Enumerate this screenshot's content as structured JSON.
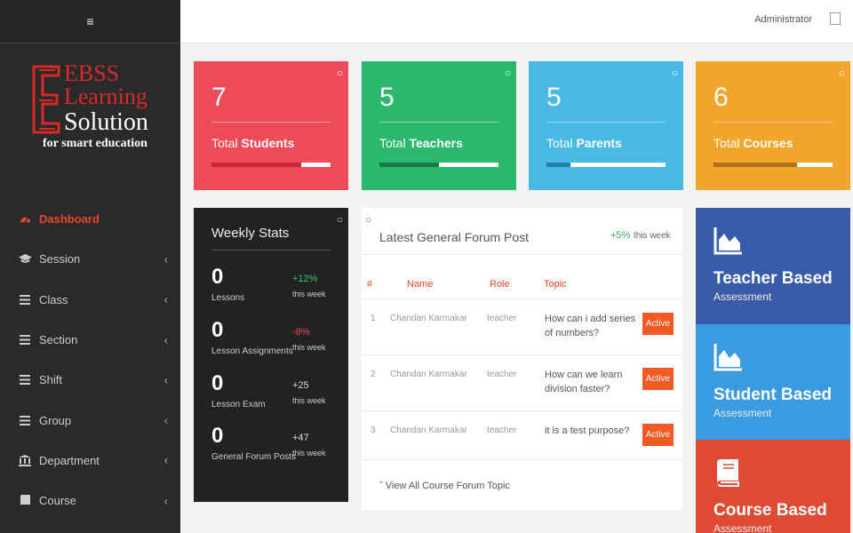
{
  "header": {
    "user": "Administrator"
  },
  "logo": {
    "line1": "EBSS",
    "line2": "Learning",
    "line3": "Solution",
    "tagline": "for smart education"
  },
  "sidebar": {
    "items": [
      {
        "label": "Dashboard",
        "icon": "dashboard-icon"
      },
      {
        "label": "Session",
        "icon": "graduation-cap-icon"
      },
      {
        "label": "Class",
        "icon": "list-icon"
      },
      {
        "label": "Section",
        "icon": "list-icon"
      },
      {
        "label": "Shift",
        "icon": "list-icon"
      },
      {
        "label": "Group",
        "icon": "list-icon"
      },
      {
        "label": "Department",
        "icon": "institution-icon"
      },
      {
        "label": "Course",
        "icon": "book-icon"
      }
    ]
  },
  "stats": [
    {
      "value": "7",
      "prefix": "Total",
      "label": "Students",
      "color": "#ee4b59",
      "progress": 0.75,
      "fill": "#c9283a"
    },
    {
      "value": "5",
      "prefix": "Total",
      "label": "Teachers",
      "color": "#2cb86c",
      "progress": 0.5,
      "fill": "#137a43"
    },
    {
      "value": "5",
      "prefix": "Total",
      "label": "Parents",
      "color": "#49b9e5",
      "progress": 0.2,
      "fill": "#1f7fa8"
    },
    {
      "value": "6",
      "prefix": "Total",
      "label": "Courses",
      "color": "#f0a52d",
      "progress": 0.7,
      "fill": "#b0701b"
    }
  ],
  "weekly": {
    "title": "Weekly Stats",
    "rows": [
      {
        "value": "0",
        "label": "Lessons",
        "change": "+12%",
        "change_color": "#3cc866",
        "period": "this week"
      },
      {
        "value": "0",
        "label": "Lesson Assignments",
        "change": "-8%",
        "change_color": "#e84a4a",
        "period": "this week"
      },
      {
        "value": "0",
        "label": "Lesson Exam",
        "change": "+25",
        "change_color": "#dddddd",
        "period": "this week"
      },
      {
        "value": "0",
        "label": "General Forum Posts",
        "change": "+47",
        "change_color": "#dddddd",
        "period": "this week"
      }
    ]
  },
  "forum": {
    "title": "Latest General Forum Post",
    "change": "+5%",
    "period": "this week",
    "headers": [
      "#",
      "Name",
      "Role",
      "Topic"
    ],
    "rows": [
      {
        "n": "1",
        "name": "Chandan Karmakar",
        "role": "teacher",
        "topic": "How can i add series of numbers?",
        "status": "Active"
      },
      {
        "n": "2",
        "name": "Chandan Karmakar",
        "role": "teacher",
        "topic": "How can we learn division faster?",
        "status": "Active"
      },
      {
        "n": "3",
        "name": "Chandan Karmakar",
        "role": "teacher",
        "topic": "it is a test purpose?",
        "status": "Active"
      }
    ],
    "view_all": "View All Course Forum Topic"
  },
  "assessments": [
    {
      "title": "Teacher Based",
      "subtitle": "Assessment",
      "color": "#3a5ba8",
      "icon": "area-chart-icon"
    },
    {
      "title": "Student Based",
      "subtitle": "Assessment",
      "color": "#3b9be0",
      "icon": "area-chart-icon"
    },
    {
      "title": "Course Based",
      "subtitle": "Assessment",
      "color": "#e04a35",
      "icon": "book-icon"
    }
  ]
}
